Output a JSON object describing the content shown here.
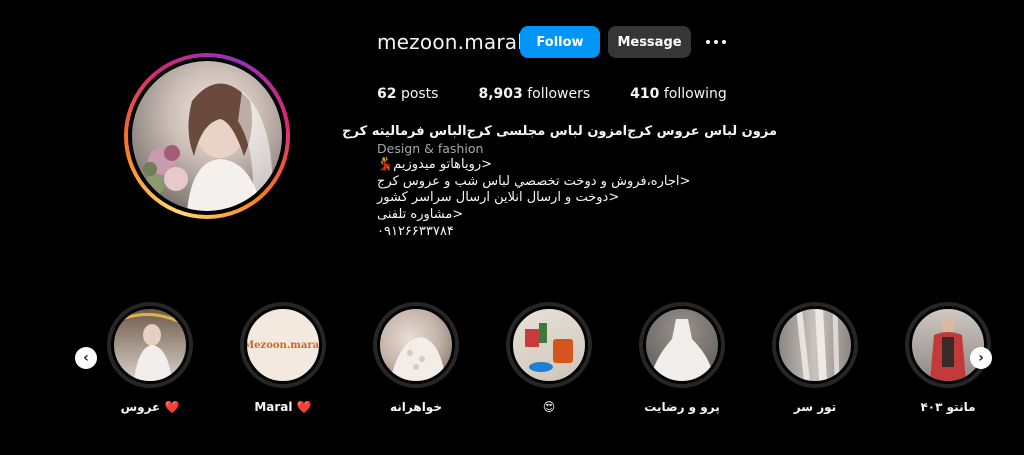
{
  "profile": {
    "username": "mezoon.maral",
    "follow_label": "Follow",
    "message_label": "Message",
    "more_icon": "more-icon",
    "posts_count": "62",
    "posts_label": "posts",
    "followers_count": "8,903",
    "followers_label": "followers",
    "following_count": "410",
    "following_label": "following"
  },
  "bio": {
    "name": "مزون لباس عروس کرج‌امزون لباس مجلسی کرج‌الباس فرمالیته کرج",
    "category": "Design & fashion",
    "lines": [
      "<رویاهاتو میدوزیم💃",
      "<اجاره،فروش و دوخت تخصصي لباس شب و عروس کرج",
      "<دوخت و ارسال انلاين ارسال سراسر کشور",
      "<مشاوره تلفنی",
      "۰۹۱۲۶۶۳۳۷۸۴"
    ]
  },
  "highlights": [
    {
      "label": "عروس",
      "emoji": "❤️"
    },
    {
      "label": "Maral",
      "emoji": "❤️",
      "image_text": "Mezoon.maral"
    },
    {
      "label": "خواهرانه",
      "emoji": ""
    },
    {
      "label": "",
      "emoji": "😍"
    },
    {
      "label": "پرو و رضایت",
      "emoji": ""
    },
    {
      "label": "تور سر",
      "emoji": ""
    },
    {
      "label": "مانتو ۴۰۳",
      "emoji": ""
    }
  ],
  "nav": {
    "prev_icon": "chevron-left-icon",
    "next_icon": "chevron-right-icon"
  },
  "colors": {
    "accent": "#0095f6",
    "background": "#000000",
    "secondary_button": "#363636"
  }
}
